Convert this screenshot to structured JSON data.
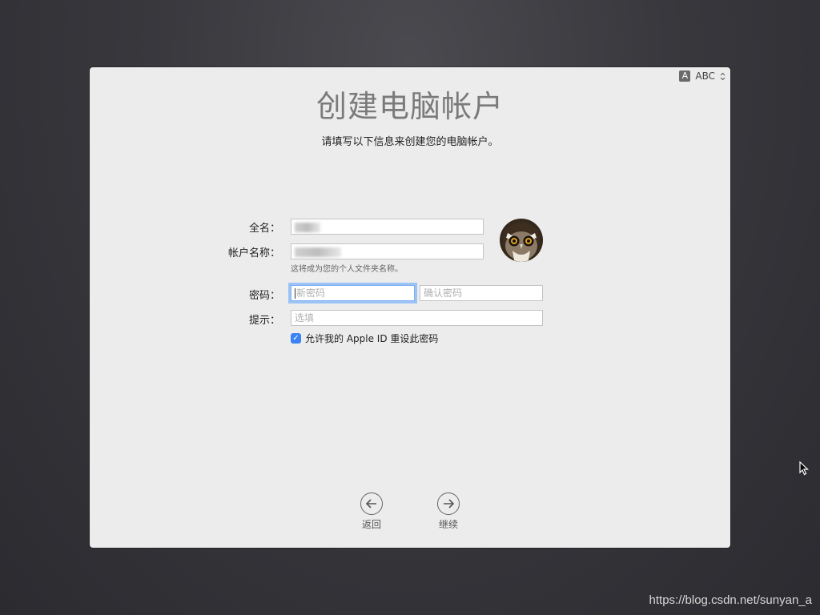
{
  "input_menu": {
    "badge": "A",
    "label": "ABC"
  },
  "header": {
    "title": "创建电脑帐户",
    "subtitle": "请填写以下信息来创建您的电脑帐户。"
  },
  "form": {
    "full_name_label": "全名：",
    "account_name_label": "帐户名称：",
    "account_hint": "这将成为您的个人文件夹名称。",
    "password_label": "密码：",
    "password_placeholder": "新密码",
    "verify_placeholder": "确认密码",
    "hint_label": "提示：",
    "hint_placeholder": "选填",
    "apple_id_reset_label": "允许我的 Apple ID 重设此密码",
    "apple_id_reset_checked": true
  },
  "nav": {
    "back_label": "返回",
    "continue_label": "继续"
  },
  "watermark": "https://blog.csdn.net/sunyan_a",
  "colors": {
    "accent": "#3b82f6",
    "focus_ring": "#9cc3f6"
  }
}
